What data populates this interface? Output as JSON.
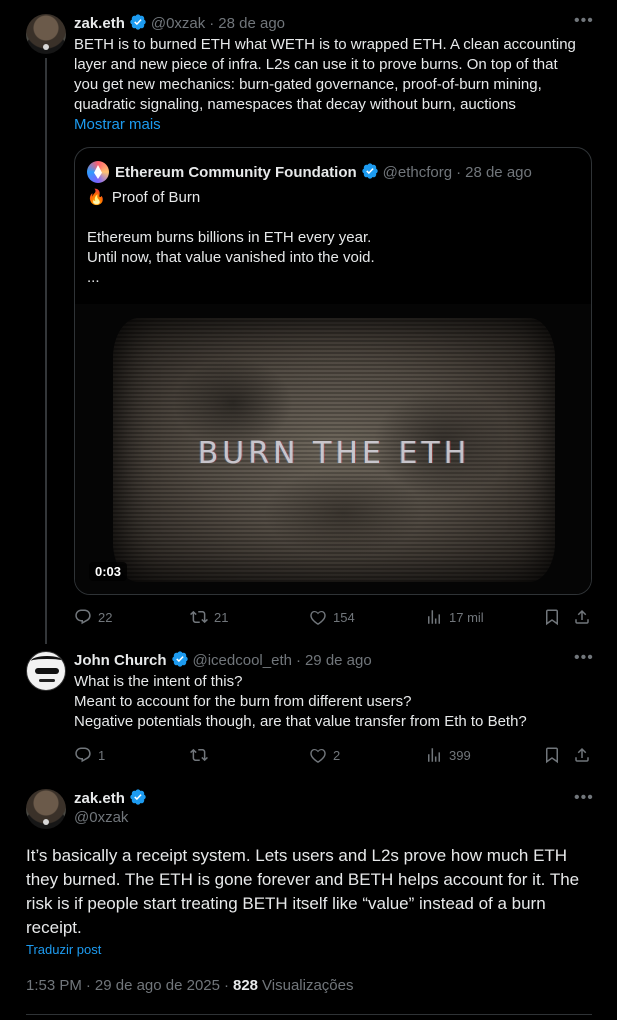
{
  "tweet1": {
    "name": "zak.eth",
    "handle": "@0xzak",
    "dot": "·",
    "date": "28 de ago",
    "lines": [
      "BETH is to burned ETH what WETH is to wrapped ETH. A clean accounting",
      "layer and new piece of infra. L2s can use it to prove burns. On top of that",
      "you get new mechanics: burn-gated governance, proof-of-burn mining,",
      "quadratic signaling, namespaces that decay without burn, auctions"
    ],
    "show_more": "Mostrar mais",
    "quote": {
      "name": "Ethereum Community Foundation",
      "handle": "@ethcforg",
      "dot": "·",
      "date": "28 de ago",
      "fire_emoji": "🔥",
      "title": "Proof of Burn",
      "lines": [
        "Ethereum burns billions in ETH every year.",
        "Until now, that value vanished into the void.",
        "..."
      ],
      "video_text": "BURN THE ETH",
      "video_duration": "0:03"
    },
    "replies": "22",
    "reposts": "21",
    "likes": "154",
    "views": "17 mil"
  },
  "tweet2": {
    "name": "John Church",
    "handle": "@icedcool_eth",
    "dot": "·",
    "date": "29 de ago",
    "lines": [
      "What is the intent of this?",
      "Meant to account for the burn from different users?",
      "Negative potentials though, are that value transfer from Eth to Beth?"
    ],
    "replies": "1",
    "reposts": "",
    "likes": "2",
    "views": "399"
  },
  "main": {
    "name": "zak.eth",
    "handle": "@0xzak",
    "lines": [
      "It’s basically a receipt system. Lets users and L2s prove how much ETH",
      "they burned. The ETH is gone forever and BETH helps account for it. The",
      "risk is if people start treating BETH itself like “value” instead of a burn",
      "receipt."
    ],
    "translate": "Traduzir post",
    "time": "1:53 PM",
    "sep1": "·",
    "date": "29 de ago de 2025",
    "sep2": "·",
    "views_count": "828",
    "views_label": "Visualizações"
  },
  "colors": {
    "accent": "#1d9bf0",
    "muted": "#71767b",
    "text": "#e7e9ea",
    "border": "#2f3336"
  },
  "icons": [
    "verified-badge-icon",
    "more-icon",
    "reply-icon",
    "repost-icon",
    "like-icon",
    "views-icon",
    "bookmark-icon",
    "share-icon",
    "fire-icon"
  ]
}
